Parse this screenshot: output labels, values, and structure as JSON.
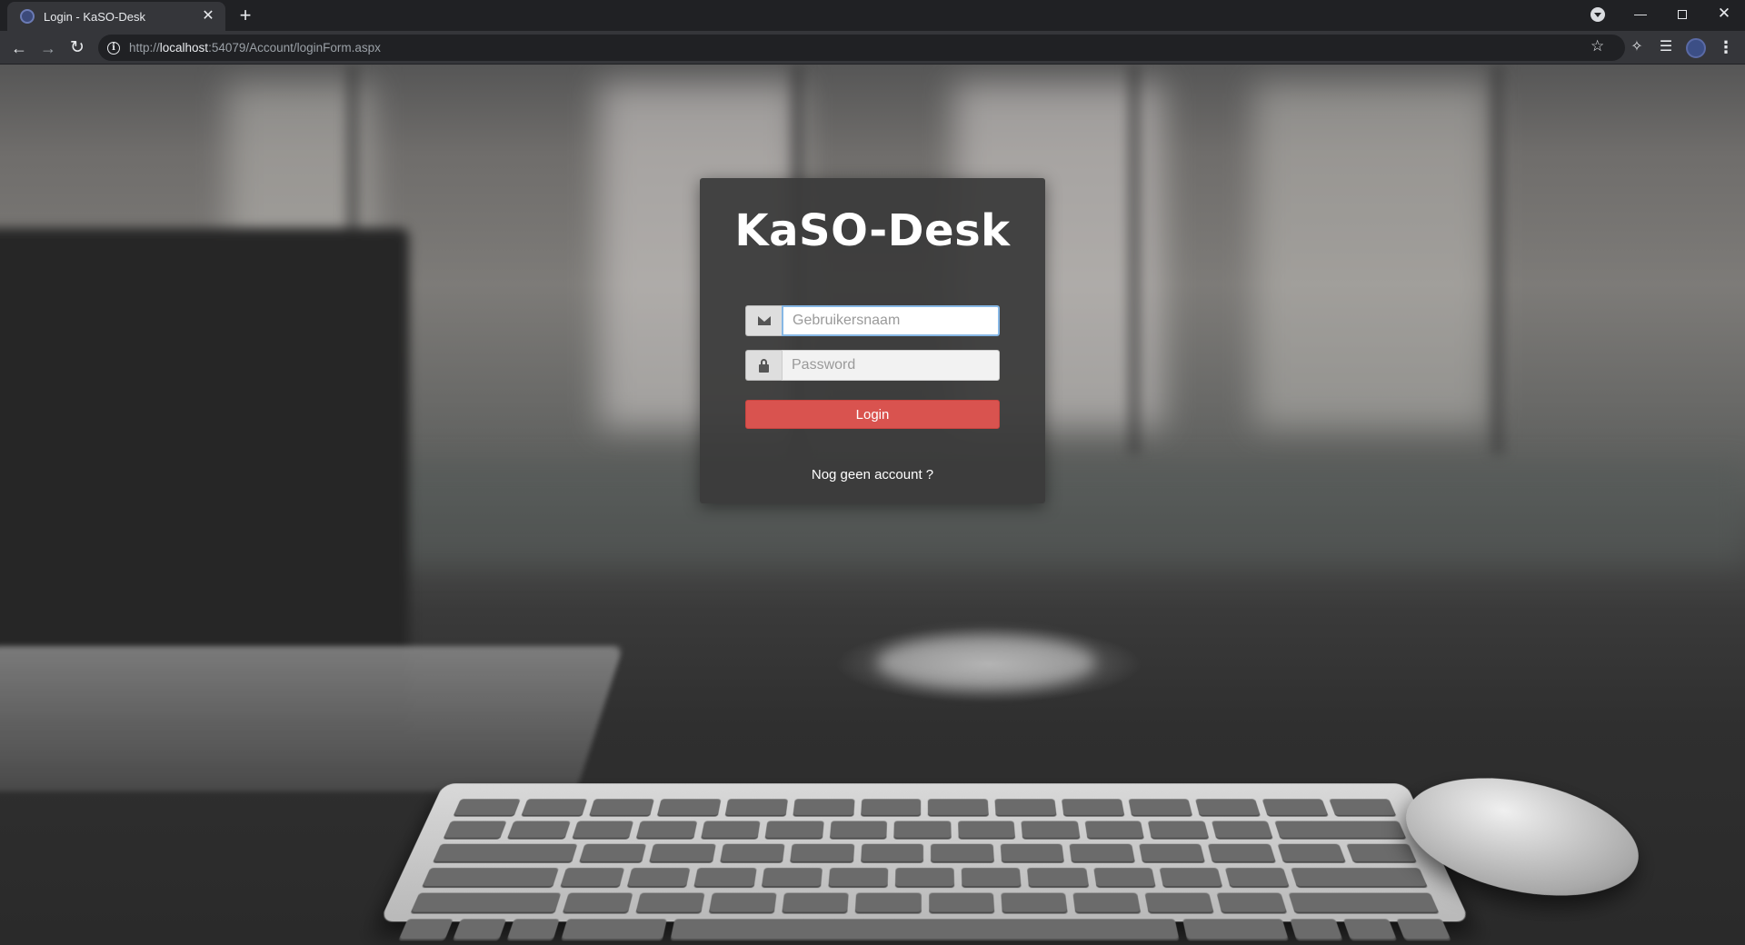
{
  "browser": {
    "tab": {
      "title": "Login - KaSO-Desk",
      "close_glyph": "✕"
    },
    "new_tab_glyph": "+",
    "address": {
      "scheme": "http://",
      "host": "localhost",
      "rest": ":54079/Account/loginForm.aspx"
    },
    "icons": {
      "back": "back-arrow-icon",
      "forward": "forward-arrow-icon",
      "reload": "reload-icon",
      "info": "info-icon",
      "star": "star-icon",
      "extensions": "puzzle-icon",
      "media": "media-queue-icon",
      "profile": "profile-avatar",
      "menu": "kebab-menu-icon"
    }
  },
  "login": {
    "brand": "KaSO-Desk",
    "username_placeholder": "Gebruikersnaam",
    "password_placeholder": "Password",
    "login_label": "Login",
    "register_link": "Nog geen account ?",
    "button_color": "#d9534f",
    "card_color": "#3a3a3a"
  }
}
